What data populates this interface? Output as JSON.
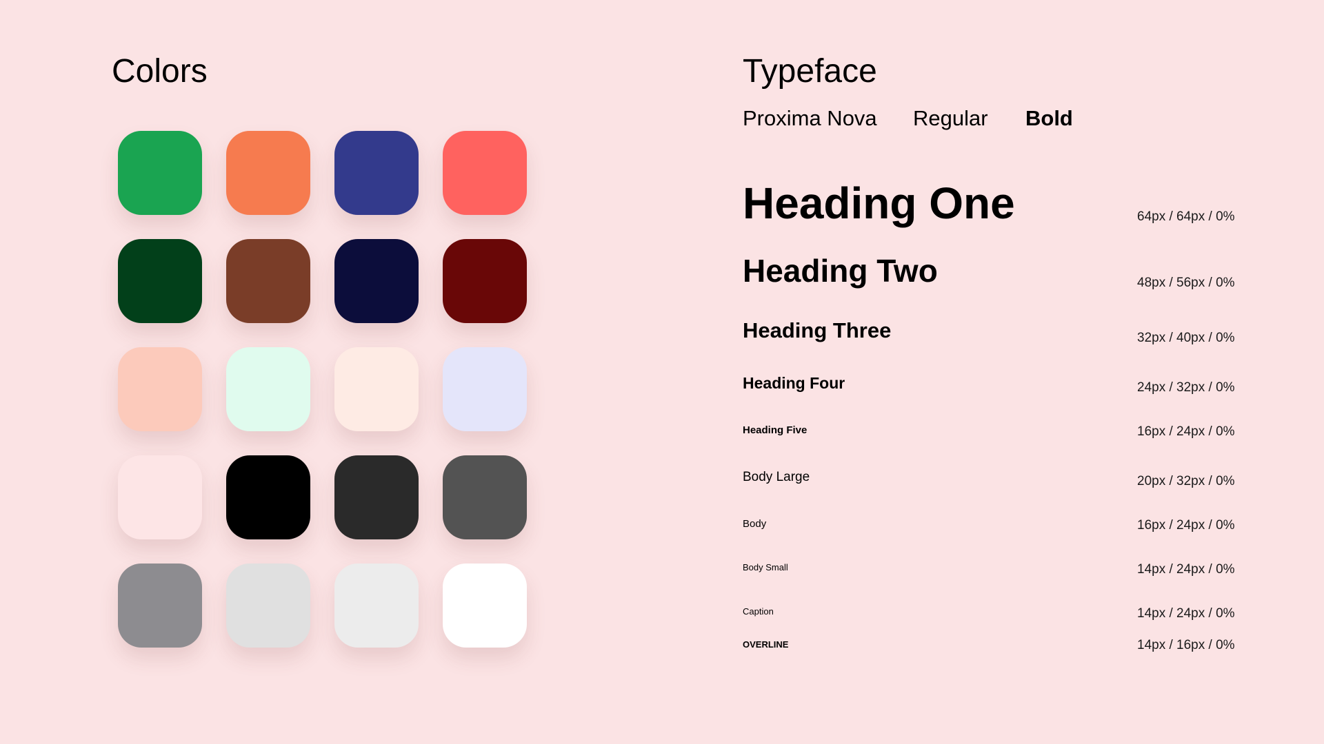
{
  "colors_section": {
    "title": "Colors",
    "swatches": [
      "#1aa451",
      "#f67b4f",
      "#333a8c",
      "#ff625f",
      "#02401a",
      "#7a3d28",
      "#0c0d3b",
      "#690707",
      "#fccabb",
      "#e0fbee",
      "#feebe4",
      "#e4e5fa",
      "#fde5e6",
      "#000000",
      "#2a2a2a",
      "#535353",
      "#8d8c90",
      "#e0e0e0",
      "#ececec",
      "#ffffff"
    ]
  },
  "typeface_section": {
    "title": "Typeface",
    "font_name": "Proxima Nova",
    "weight_regular": "Regular",
    "weight_bold": "Bold",
    "styles": [
      {
        "name": "Heading One",
        "spec": "64px / 64px / 0%"
      },
      {
        "name": "Heading Two",
        "spec": "48px / 56px / 0%"
      },
      {
        "name": "Heading Three",
        "spec": "32px / 40px / 0%"
      },
      {
        "name": "Heading Four",
        "spec": "24px / 32px / 0%"
      },
      {
        "name": "Heading Five",
        "spec": "16px / 24px / 0%"
      },
      {
        "name": "Body Large",
        "spec": "20px / 32px / 0%"
      },
      {
        "name": "Body",
        "spec": "16px / 24px / 0%"
      },
      {
        "name": "Body Small",
        "spec": "14px / 24px / 0%"
      },
      {
        "name": "Caption",
        "spec": "14px / 24px / 0%"
      },
      {
        "name": "OVERLINE",
        "spec": "14px / 16px / 0%"
      }
    ]
  }
}
